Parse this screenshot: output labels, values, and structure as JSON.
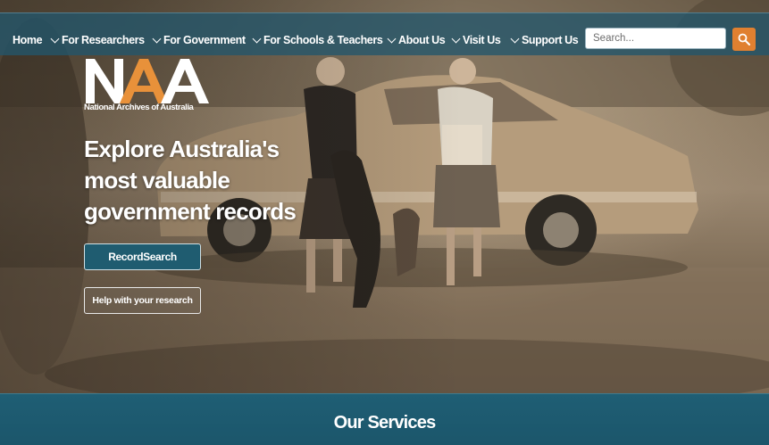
{
  "nav": {
    "items": [
      {
        "label": "Home",
        "has_dropdown": false
      },
      {
        "label": "For Researchers",
        "has_dropdown": true
      },
      {
        "label": "For Government",
        "has_dropdown": true
      },
      {
        "label": "For Schools & Teachers",
        "has_dropdown": true
      },
      {
        "label": "About Us",
        "has_dropdown": true
      },
      {
        "label": "Visit Us",
        "has_dropdown": true
      },
      {
        "label": "Support Us",
        "has_dropdown": true
      }
    ],
    "search_placeholder": "Search...",
    "search_icon": "magnifier-icon"
  },
  "logo": {
    "mark": "NAA",
    "wordmark": "National Archives of Australia"
  },
  "hero": {
    "headline_lines": [
      "Explore Australia's",
      "most valuable",
      "government records"
    ],
    "primary_button": "RecordSearch",
    "secondary_button": "Help with your research"
  },
  "services": {
    "title": "Our Services"
  },
  "colors": {
    "nav_bg": "#22566c",
    "accent_orange": "#e08030",
    "teal": "#1f5c70"
  }
}
